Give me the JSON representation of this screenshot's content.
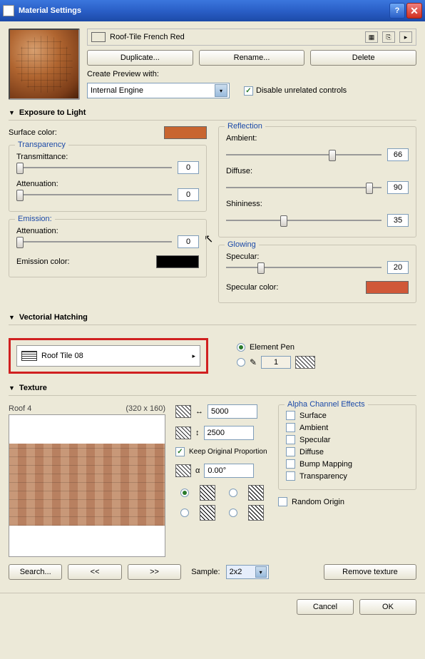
{
  "titlebar": {
    "title": "Material Settings"
  },
  "material": {
    "name": "Roof-Tile French Red",
    "swatch": "#c86530"
  },
  "buttons": {
    "duplicate": "Duplicate...",
    "rename": "Rename...",
    "delete": "Delete"
  },
  "preview": {
    "label": "Create Preview with:",
    "engine": "Internal Engine",
    "disable_label": "Disable unrelated controls"
  },
  "sections": {
    "exposure": "Exposure to Light",
    "hatching": "Vectorial Hatching",
    "texture": "Texture"
  },
  "surface": {
    "label": "Surface color:",
    "color": "#c86530"
  },
  "transparency": {
    "title": "Transparency",
    "transmittance_label": "Transmittance:",
    "transmittance_val": "0",
    "attenuation_label": "Attenuation:",
    "attenuation_val": "0"
  },
  "emission": {
    "title": "Emission:",
    "attenuation_label": "Attenuation:",
    "attenuation_val": "0",
    "color_label": "Emission color:",
    "color": "#000000"
  },
  "reflection": {
    "title": "Reflection",
    "ambient_label": "Ambient:",
    "ambient_val": "66",
    "diffuse_label": "Diffuse:",
    "diffuse_val": "90",
    "shininess_label": "Shininess:",
    "shininess_val": "35"
  },
  "glowing": {
    "title": "Glowing",
    "specular_label": "Specular:",
    "specular_val": "20",
    "color_label": "Specular color:",
    "color": "#d05838"
  },
  "hatching": {
    "name": "Roof Tile 08",
    "element_pen": "Element Pen",
    "pen_num": "1"
  },
  "texture": {
    "name": "Roof 4",
    "dims": "(320 x 160)",
    "width": "5000",
    "height": "2500",
    "keep_prop": "Keep Original Proportion",
    "angle": "0.00°"
  },
  "alpha": {
    "title": "Alpha Channel Effects",
    "items": [
      "Surface",
      "Ambient",
      "Specular",
      "Diffuse",
      "Bump Mapping",
      "Transparency"
    ],
    "random": "Random Origin"
  },
  "bottom": {
    "search": "Search...",
    "prev": "<<",
    "next": ">>",
    "sample_label": "Sample:",
    "sample_val": "2x2",
    "remove": "Remove texture"
  },
  "footer": {
    "cancel": "Cancel",
    "ok": "OK"
  }
}
